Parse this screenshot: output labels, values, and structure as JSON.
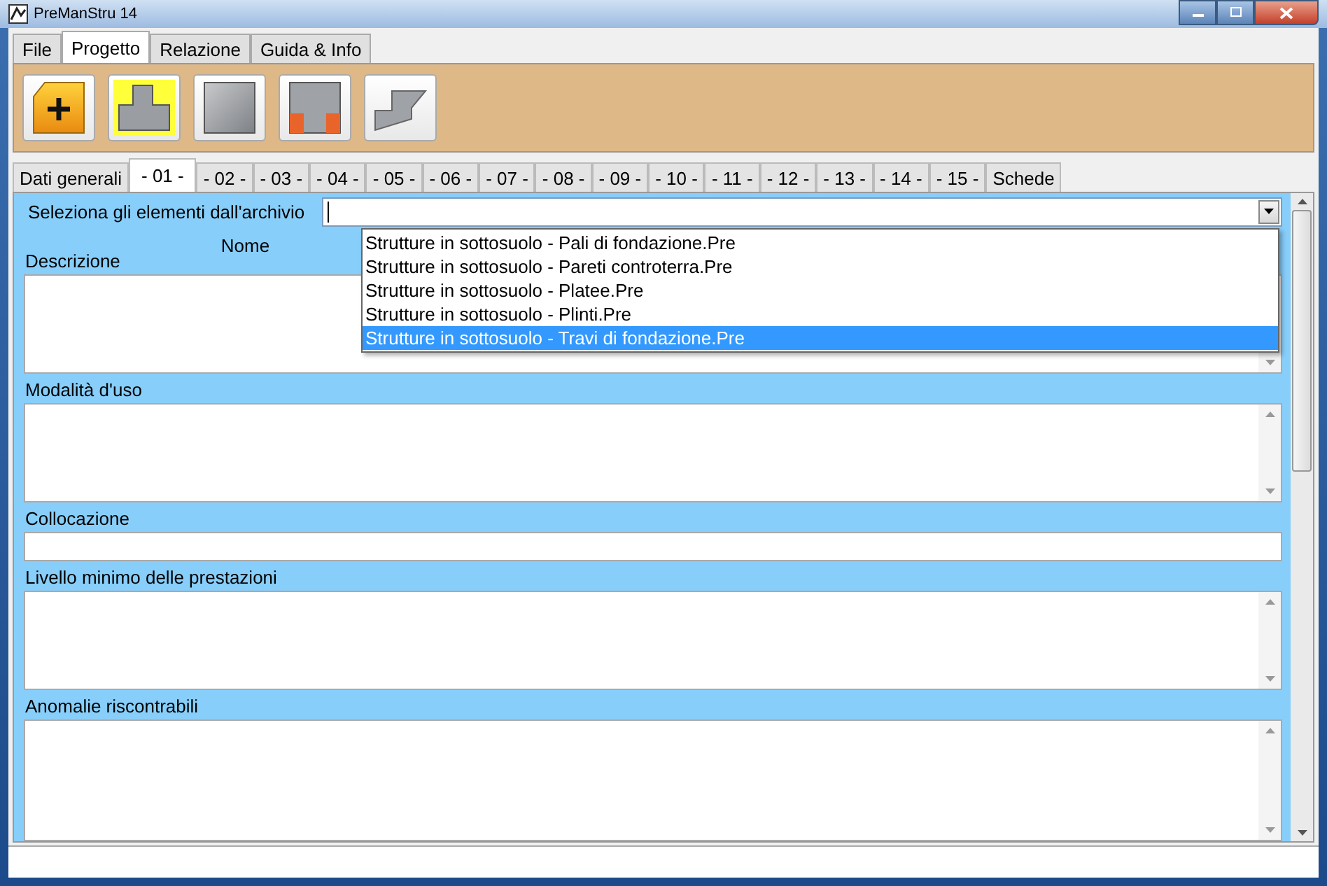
{
  "window": {
    "title": "PreManStru 14"
  },
  "menu_tabs": [
    {
      "label": "File",
      "selected": false
    },
    {
      "label": "Progetto",
      "selected": true
    },
    {
      "label": "Relazione",
      "selected": false
    },
    {
      "label": "Guida & Info",
      "selected": false
    }
  ],
  "toolbar": [
    {
      "kind": "add"
    },
    {
      "kind": "tee"
    },
    {
      "kind": "square"
    },
    {
      "kind": "portal"
    },
    {
      "kind": "step"
    }
  ],
  "page_tabs": [
    {
      "label": "Dati generali",
      "selected": false
    },
    {
      "label": "- 01 -",
      "selected": true
    },
    {
      "label": "- 02 -",
      "selected": false
    },
    {
      "label": "- 03 -",
      "selected": false
    },
    {
      "label": "- 04 -",
      "selected": false
    },
    {
      "label": "- 05 -",
      "selected": false
    },
    {
      "label": "- 06 -",
      "selected": false
    },
    {
      "label": "- 07 -",
      "selected": false
    },
    {
      "label": "- 08 -",
      "selected": false
    },
    {
      "label": "- 09 -",
      "selected": false
    },
    {
      "label": "- 10 -",
      "selected": false
    },
    {
      "label": "- 11 -",
      "selected": false
    },
    {
      "label": "- 12 -",
      "selected": false
    },
    {
      "label": "- 13 -",
      "selected": false
    },
    {
      "label": "- 14 -",
      "selected": false
    },
    {
      "label": "- 15 -",
      "selected": false
    },
    {
      "label": "Schede",
      "selected": false
    }
  ],
  "archive": {
    "label": "Seleziona gli elementi dall'archivio",
    "options": [
      {
        "label": "Strutture in sottosuolo - Pali di fondazione.Pre",
        "selected": false
      },
      {
        "label": "Strutture in sottosuolo - Pareti controterra.Pre",
        "selected": false
      },
      {
        "label": "Strutture in sottosuolo - Platee.Pre",
        "selected": false
      },
      {
        "label": "Strutture in sottosuolo - Plinti.Pre",
        "selected": false
      },
      {
        "label": "Strutture in sottosuolo - Travi di fondazione.Pre",
        "selected": true
      }
    ]
  },
  "name_label": "Nome",
  "fields": [
    {
      "label": "Descrizione",
      "kind": "textarea"
    },
    {
      "label": "Modalità d'uso",
      "kind": "textarea"
    },
    {
      "label": "Collocazione",
      "kind": "input"
    },
    {
      "label": "Livello minimo delle prestazioni",
      "kind": "textarea"
    },
    {
      "label": "Anomalie riscontrabili",
      "kind": "textarea"
    }
  ]
}
